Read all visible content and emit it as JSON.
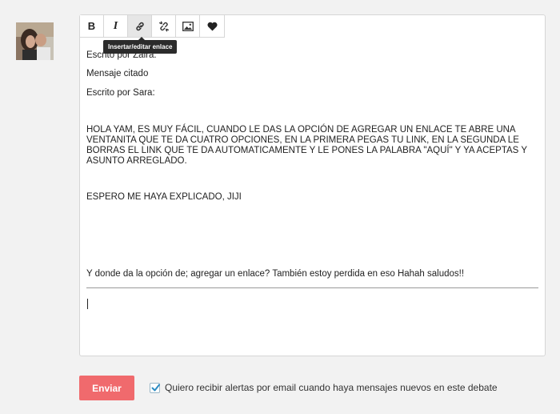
{
  "tooltip": "Insertar/editar enlace",
  "toolbar": {
    "bold": "B",
    "italic": "I",
    "link": "link-icon",
    "unlink": "unlink-icon",
    "image": "image-icon",
    "emoji": "heart-icon"
  },
  "content": {
    "written_by_zaira": "Escrito por Zaira:",
    "quoted_message": "Mensaje citado",
    "written_by_sara": "Escrito por Sara:",
    "paragraph_1": "HOLA YAM, ES MUY FÁCIL, CUANDO LE DAS LA OPCIÓN DE AGREGAR UN ENLACE TE ABRE UNA VENTANITA QUE TE DA CUATRO OPCIONES, EN LA PRIMERA PEGAS TU LINK, EN LA SEGUNDA LE BORRAS EL LINK QUE TE DA AUTOMATICAMENTE Y LE PONES LA PALABRA \"AQUÍ\" Y YA ACEPTAS Y ASUNTO ARREGLADO.",
    "paragraph_2": "ESPERO ME HAYA EXPLICADO, JIJI",
    "reply": "Y donde da la opción de; agregar un enlace? También estoy perdida en eso Hahah saludos!!"
  },
  "send_label": "Enviar",
  "alert": {
    "label": "Quiero recibir alertas por email cuando haya mensajes nuevos en este debate",
    "checked": true
  },
  "colors": {
    "send_button": "#f06a6d",
    "checkmark": "#2b8cc4"
  }
}
